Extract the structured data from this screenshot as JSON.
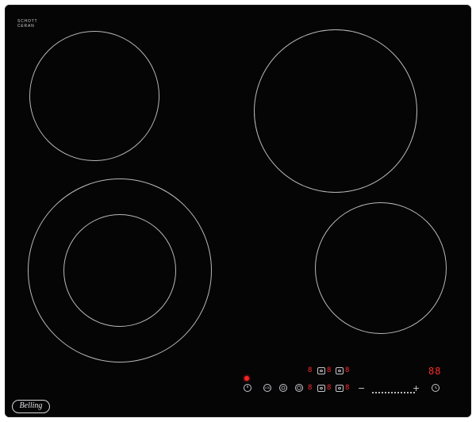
{
  "hob": {
    "surface_color": "#050506",
    "ring_color": "#b8b8bc",
    "display_color": "#ff2a2a"
  },
  "branding": {
    "schott_line1": "SCHOTT",
    "schott_line2": "CERAN",
    "brand_name": "Belling"
  },
  "controls": {
    "power_icon": "power-icon",
    "lock_label": "LCK",
    "zone_icons": [
      "zone-front-icon",
      "zone-dual-icon"
    ],
    "zone_displays_top": [
      "8",
      "8",
      "8"
    ],
    "zone_displays_bottom": [
      "8",
      "8",
      "8"
    ],
    "minus_label": "−",
    "plus_label": "+",
    "timer_display": "88",
    "timer_icon": "clock-icon"
  }
}
